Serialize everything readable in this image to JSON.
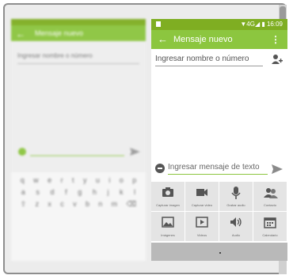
{
  "left_phone": {
    "title": "Mensaje nuevo",
    "to_placeholder": "Ingresar nombre o número",
    "compose_placeholder": "Ingresar mensaje de texto",
    "keyboard_rows": [
      [
        "q",
        "w",
        "e",
        "r",
        "t",
        "y",
        "u",
        "i",
        "o",
        "p"
      ],
      [
        "a",
        "s",
        "d",
        "f",
        "g",
        "h",
        "j",
        "k",
        "l"
      ],
      [
        "⇧",
        "z",
        "x",
        "c",
        "v",
        "b",
        "n",
        "m",
        "⌫"
      ]
    ]
  },
  "right_phone": {
    "status_text": "4G",
    "time": "16:09",
    "title": "Mensaje nuevo",
    "menu_glyph": "⋮",
    "back_glyph": "←",
    "to_placeholder": "Ingresar nombre o número",
    "compose_placeholder": "Ingresar mensaje de texto",
    "attachments": [
      {
        "label": "Capturar imagen",
        "icon": "camera-icon"
      },
      {
        "label": "Capturar video",
        "icon": "video-camera-icon"
      },
      {
        "label": "Grabar audio",
        "icon": "microphone-icon"
      },
      {
        "label": "Contacto",
        "icon": "contacts-icon"
      },
      {
        "label": "Imágenes",
        "icon": "image-icon"
      },
      {
        "label": "Videos",
        "icon": "play-icon"
      },
      {
        "label": "Audio",
        "icon": "speaker-icon"
      },
      {
        "label": "Calendario",
        "icon": "calendar-icon"
      }
    ]
  },
  "colors": {
    "accent": "#8cc63f",
    "status": "#7fae22"
  }
}
